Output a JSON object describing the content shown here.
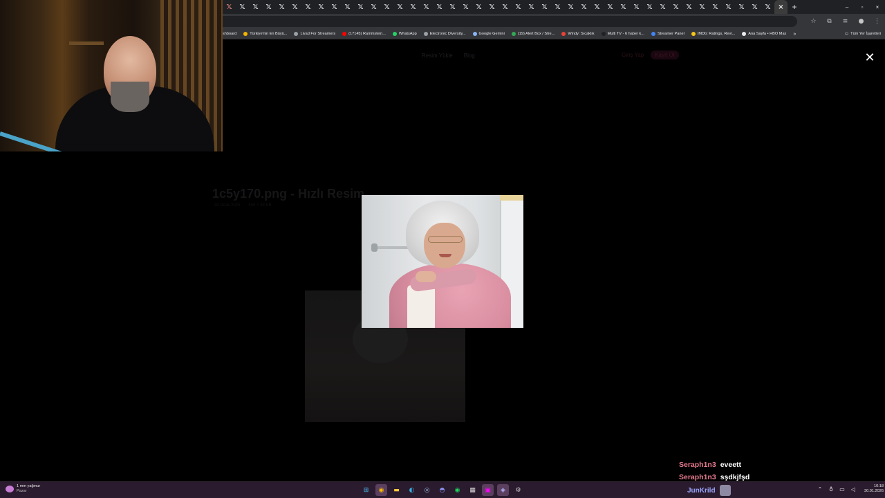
{
  "browser": {
    "tab_count": 43,
    "tab_icon": "x-logo-icon",
    "active_tab_close": "×",
    "new_tab": "+",
    "window_controls": [
      "–",
      "▫",
      "×"
    ],
    "bookmarks": [
      {
        "label": "shboard",
        "color": "#35363a"
      },
      {
        "label": "Türkiye'nin En Büyü...",
        "color": "#f4b400"
      },
      {
        "label": "Livad For Streamers",
        "color": "#9aa0a6"
      },
      {
        "label": "(17145) Rammstein...",
        "color": "#ff0000"
      },
      {
        "label": "WhatsApp",
        "color": "#25d366"
      },
      {
        "label": "Electronic Diversity...",
        "color": "#9aa0a6"
      },
      {
        "label": "Google Gemini",
        "color": "#8ab4f8"
      },
      {
        "label": "(19) Alert Box / Stre...",
        "color": "#34a853"
      },
      {
        "label": "Windy: Sıcaklık",
        "color": "#ea4335"
      },
      {
        "label": "Multi TV - 6 haber k...",
        "color": "#202124"
      },
      {
        "label": "Streamer Panel",
        "color": "#4285f4"
      },
      {
        "label": "IMDb: Ratings, Revi...",
        "color": "#f5c518"
      },
      {
        "label": "Ana Sayfa • HBO Max",
        "color": "#e8eaed"
      }
    ],
    "bookmarks_more": "»",
    "all_bookmarks": "Tüm Yer İşaretleri"
  },
  "page": {
    "nav": [
      "Resim Yükle",
      "Blog"
    ],
    "login": "Giriş Yap",
    "signup": "Kayıt Ol",
    "title": "1c5y170.png - Hızlı Resim",
    "meta": [
      "30 Ocak 2026",
      "406 × 33 KB"
    ]
  },
  "lightbox": {
    "close_label": "✕"
  },
  "chat": [
    {
      "user": "Seraph1n3",
      "message": "eveett"
    },
    {
      "user": "Seraph1n3",
      "message": "sşdkjfşd"
    }
  ],
  "taskbar": {
    "weather": "1 mm yağmur",
    "weather_sub": "Pazar",
    "tray_user": "JunKrild",
    "time": "10:18",
    "date": "30.01.2026"
  }
}
